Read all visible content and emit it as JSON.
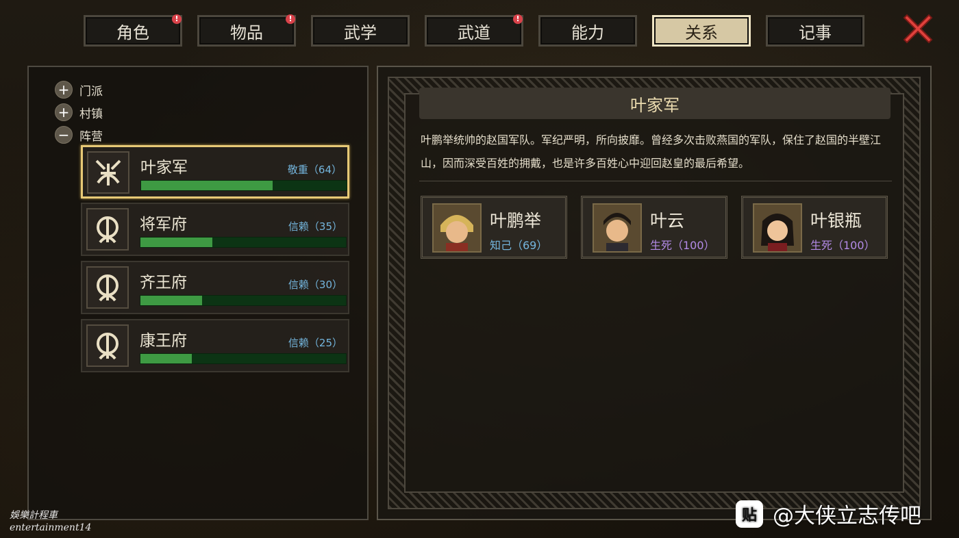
{
  "tabs": [
    {
      "label": "角色",
      "badge": "!"
    },
    {
      "label": "物品",
      "badge": "!"
    },
    {
      "label": "武学",
      "badge": ""
    },
    {
      "label": "武道",
      "badge": "!"
    },
    {
      "label": "能力",
      "badge": ""
    },
    {
      "label": "关系",
      "badge": "",
      "active": true
    },
    {
      "label": "记事",
      "badge": ""
    }
  ],
  "tree": {
    "sect": {
      "symbol": "+",
      "label": "门派"
    },
    "village": {
      "symbol": "+",
      "label": "村镇"
    },
    "camp": {
      "symbol": "−",
      "label": "阵营"
    }
  },
  "factions": [
    {
      "name": "叶家军",
      "relation": "敬重（64）",
      "progress": 0.64,
      "selected": true
    },
    {
      "name": "将军府",
      "relation": "信赖（35）",
      "progress": 0.35
    },
    {
      "name": "齐王府",
      "relation": "信赖（30）",
      "progress": 0.3
    },
    {
      "name": "康王府",
      "relation": "信赖（25）",
      "progress": 0.25
    }
  ],
  "detail": {
    "title": "叶家军",
    "description": "叶鹏举统帅的赵国军队。军纪严明，所向披靡。曾经多次击败燕国的军队，保住了赵国的半壁江山，因而深受百姓的拥戴，也是许多百姓心中迎回赵皇的最后希望。",
    "members": [
      {
        "name": "叶鹏举",
        "relation": "知己（69）",
        "color": "#74b6de"
      },
      {
        "name": "叶云",
        "relation": "生死（100）",
        "color": "#b48be8"
      },
      {
        "name": "叶银瓶",
        "relation": "生死（100）",
        "color": "#b48be8"
      }
    ]
  },
  "watermark": {
    "icon": "贴",
    "text": "@大侠立志传吧"
  },
  "corner_tag": {
    "line1": "娛樂計程車",
    "line2": "entertainment14"
  },
  "colors": {
    "accent": "#e7c976",
    "bar_fill": "#3e9a43",
    "badge": "#d8424a",
    "close": "#e0413c"
  }
}
